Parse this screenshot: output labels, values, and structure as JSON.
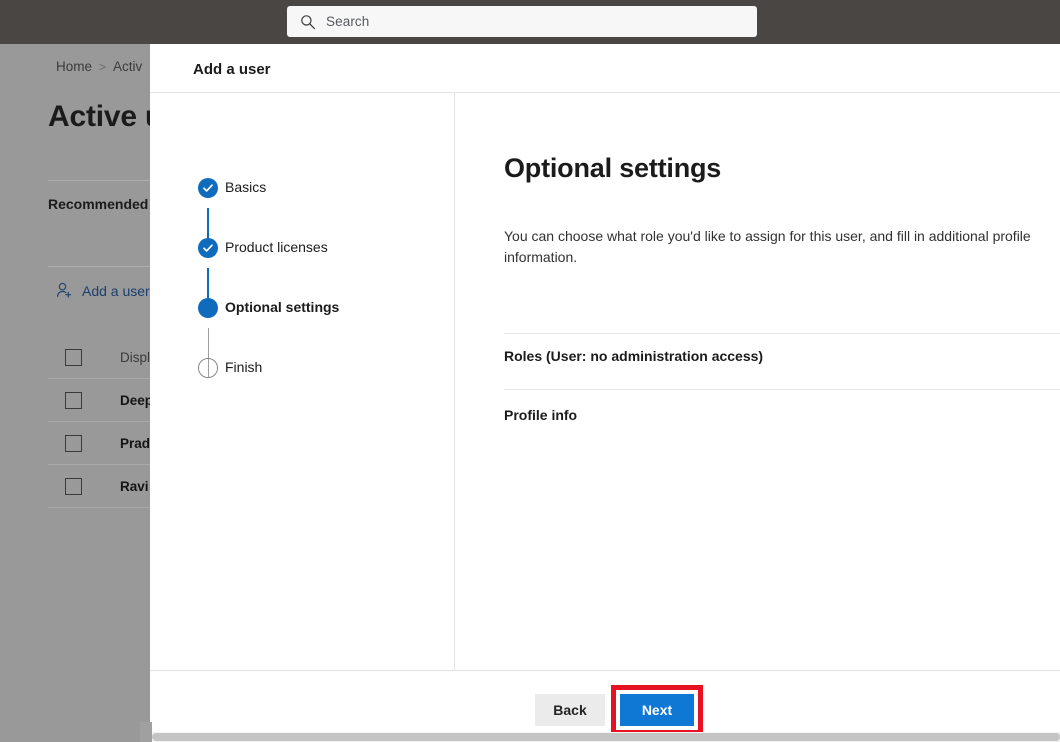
{
  "appbar": {
    "search": {
      "placeholder": "Search",
      "value": "",
      "icon": "search-icon"
    }
  },
  "backdrop": {
    "breadcrumb": {
      "home": "Home",
      "separator": ">",
      "current": "Activ"
    },
    "page_title": "Active u",
    "recommended_label": "Recommended",
    "add_user_link": {
      "label": "Add a user",
      "icon": "add-person-icon"
    },
    "table": {
      "rows": [
        {
          "cell": "Display",
          "is_header": true
        },
        {
          "cell": "Deepa",
          "is_header": false
        },
        {
          "cell": "Pradee",
          "is_header": false
        },
        {
          "cell": "Ravi K",
          "is_header": false
        }
      ]
    },
    "overlay_color": "#999999"
  },
  "dialog": {
    "title": "Add a user",
    "steps": [
      {
        "label": "Basics",
        "state": "done"
      },
      {
        "label": "Product licenses",
        "state": "done"
      },
      {
        "label": "Optional settings",
        "state": "current"
      },
      {
        "label": "Finish",
        "state": "todo"
      }
    ],
    "content": {
      "heading": "Optional settings",
      "description": "You can choose what role you'd like to assign for this user, and fill in additional profile information.",
      "sections": [
        {
          "label": "Roles (User: no administration access)"
        },
        {
          "label": "Profile info"
        }
      ]
    },
    "footer": {
      "back_label": "Back",
      "next_label": "Next"
    }
  },
  "colors": {
    "accent_blue": "#0f6cbd",
    "button_blue": "#0f78d4",
    "highlight_red": "#e81123",
    "appbar_dark": "#4a4644"
  }
}
